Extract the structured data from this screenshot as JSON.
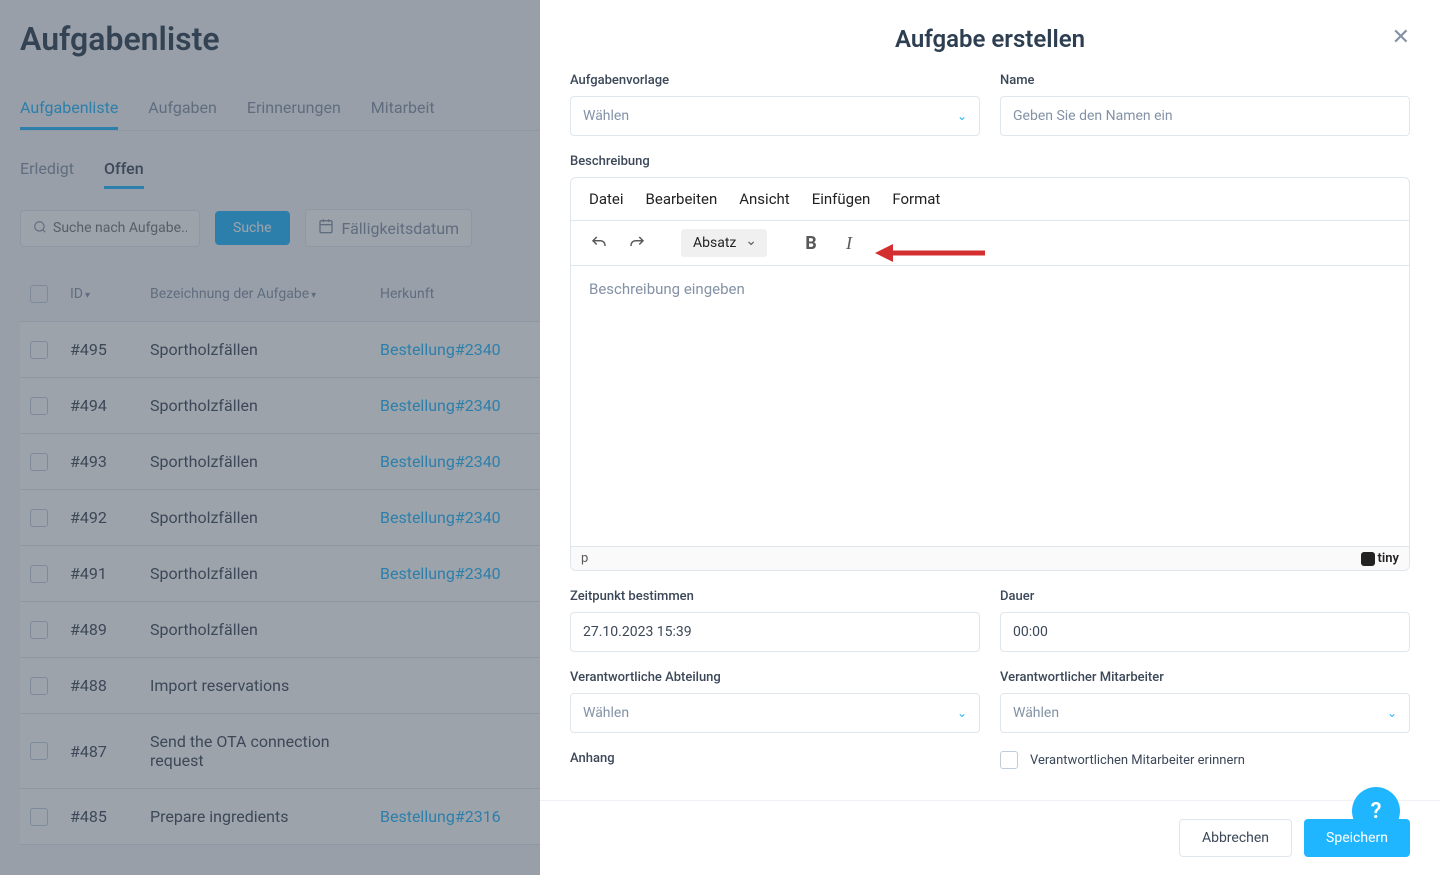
{
  "page": {
    "title": "Aufgabenliste",
    "main_tabs": [
      "Aufgabenliste",
      "Aufgaben",
      "Erinnerungen",
      "Mitarbeit"
    ],
    "sub_tabs": [
      "Erledigt",
      "Offen"
    ],
    "search_placeholder": "Suche nach Aufgabe...",
    "search_btn": "Suche",
    "date_filter": "Fälligkeitsdatum",
    "cols": {
      "id": "ID",
      "name": "Bezeichnung der Aufgabe",
      "origin": "Herkunft"
    }
  },
  "tasks": [
    {
      "id": "#495",
      "name": "Sportholzfällen",
      "origin": "Bestellung#2340"
    },
    {
      "id": "#494",
      "name": "Sportholzfällen",
      "origin": "Bestellung#2340"
    },
    {
      "id": "#493",
      "name": "Sportholzfällen",
      "origin": "Bestellung#2340"
    },
    {
      "id": "#492",
      "name": "Sportholzfällen",
      "origin": "Bestellung#2340"
    },
    {
      "id": "#491",
      "name": "Sportholzfällen",
      "origin": "Bestellung#2340"
    },
    {
      "id": "#489",
      "name": "Sportholzfällen",
      "origin": ""
    },
    {
      "id": "#488",
      "name": "Import reservations",
      "origin": ""
    },
    {
      "id": "#487",
      "name": "Send the OTA connection request",
      "origin": ""
    },
    {
      "id": "#485",
      "name": "Prepare ingredients",
      "origin": "Bestellung#2316"
    }
  ],
  "modal": {
    "title": "Aufgabe erstellen",
    "labels": {
      "template": "Aufgabenvorlage",
      "name": "Name",
      "description": "Beschreibung",
      "timing": "Zeitpunkt bestimmen",
      "duration": "Dauer",
      "department": "Verantwortliche Abteilung",
      "employee": "Verantwortlicher Mitarbeiter",
      "attachment": "Anhang",
      "remind": "Verantwortlichen Mitarbeiter erinnern"
    },
    "select_placeholder": "Wählen",
    "name_placeholder": "Geben Sie den Namen ein",
    "editor": {
      "menu": [
        "Datei",
        "Bearbeiten",
        "Ansicht",
        "Einfügen",
        "Format"
      ],
      "format_option": "Absatz",
      "placeholder": "Beschreibung eingeben",
      "path": "p",
      "branding": "tiny"
    },
    "timing_value": "27.10.2023 15:39",
    "duration_value": "00:00",
    "cancel": "Abbrechen",
    "save": "Speichern"
  },
  "help": "?"
}
